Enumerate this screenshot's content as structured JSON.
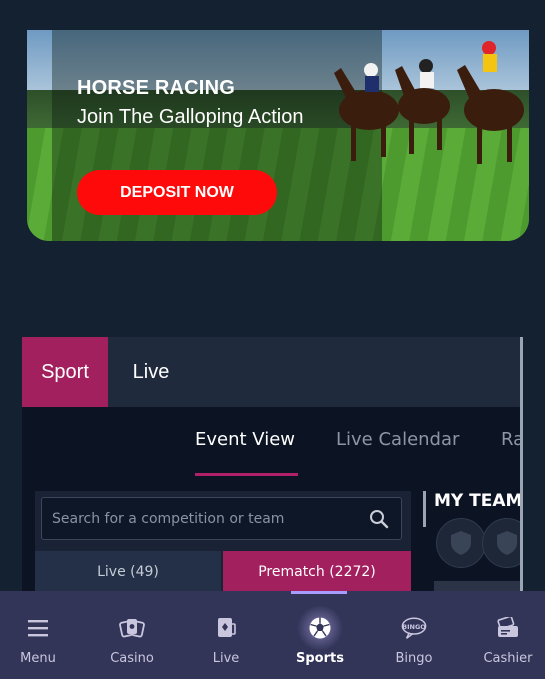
{
  "banner": {
    "title": "HORSE RACING",
    "subtitle": "Join The Galloping Action",
    "cta_label": "DEPOSIT NOW"
  },
  "sports_widget": {
    "top_tabs": [
      {
        "label": "Sport",
        "active": true
      },
      {
        "label": "Live",
        "active": false
      }
    ],
    "view_tabs": [
      {
        "label": "Event View",
        "active": true
      },
      {
        "label": "Live Calendar",
        "active": false
      },
      {
        "label": "Ra",
        "active": false
      }
    ],
    "search": {
      "placeholder": "Search for a competition or team",
      "icon": "search-icon"
    },
    "filters": [
      {
        "label": "Live (49)",
        "active": false
      },
      {
        "label": "Prematch (2272)",
        "active": true
      }
    ],
    "my_team_heading": "MY TEAM"
  },
  "bottom_nav": {
    "items": [
      {
        "label": "Menu",
        "icon": "hamburger-menu-icon",
        "active": false
      },
      {
        "label": "Casino",
        "icon": "casino-cards-icon",
        "active": false
      },
      {
        "label": "Live",
        "icon": "live-cards-icon",
        "active": false
      },
      {
        "label": "Sports",
        "icon": "soccer-ball-icon",
        "active": true
      },
      {
        "label": "Bingo",
        "icon": "bingo-bubble-icon",
        "active": false
      },
      {
        "label": "Cashier",
        "icon": "wallet-icon",
        "active": false
      }
    ]
  },
  "colors": {
    "background": "#142130",
    "accent": "#a3205f",
    "cta": "#ff0a0a",
    "nav_background": "#333558",
    "nav_active": "#a99cff"
  }
}
